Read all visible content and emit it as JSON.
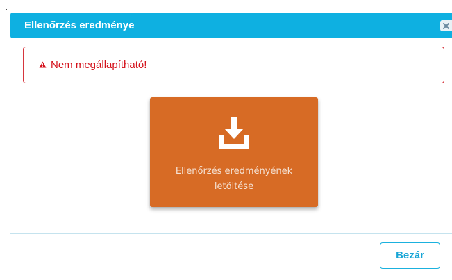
{
  "dialog": {
    "title": "Ellenőrzés eredménye",
    "close_icon": "close-x-icon"
  },
  "alert": {
    "icon": "warning-triangle-icon",
    "message": "Nem megállapítható!",
    "color": "#d4111b"
  },
  "download": {
    "icon": "download-tray-icon",
    "label_line1": "Ellenőrzés eredményének",
    "label_line2": "letöltése",
    "color": "#d76b25"
  },
  "footer": {
    "close_label": "Bezár"
  },
  "colors": {
    "header": "#0eb0e1",
    "accent": "#17a5d6"
  }
}
